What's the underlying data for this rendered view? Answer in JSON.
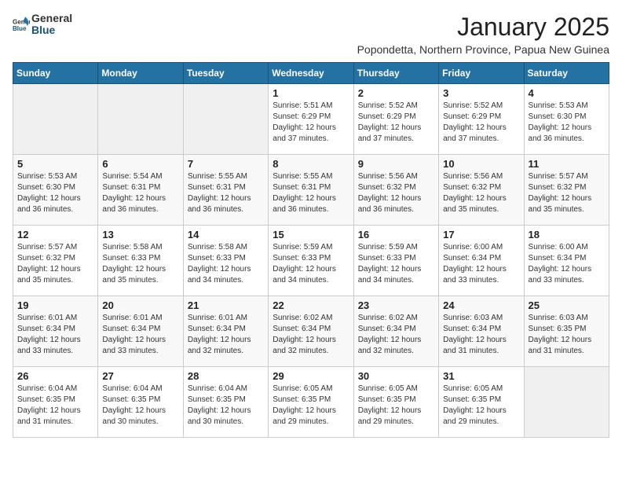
{
  "logo": {
    "text_general": "General",
    "text_blue": "Blue"
  },
  "title": "January 2025",
  "location": "Popondetta, Northern Province, Papua New Guinea",
  "days_of_week": [
    "Sunday",
    "Monday",
    "Tuesday",
    "Wednesday",
    "Thursday",
    "Friday",
    "Saturday"
  ],
  "weeks": [
    [
      {
        "day": "",
        "content": ""
      },
      {
        "day": "",
        "content": ""
      },
      {
        "day": "",
        "content": ""
      },
      {
        "day": "1",
        "content": "Sunrise: 5:51 AM\nSunset: 6:29 PM\nDaylight: 12 hours\nand 37 minutes."
      },
      {
        "day": "2",
        "content": "Sunrise: 5:52 AM\nSunset: 6:29 PM\nDaylight: 12 hours\nand 37 minutes."
      },
      {
        "day": "3",
        "content": "Sunrise: 5:52 AM\nSunset: 6:29 PM\nDaylight: 12 hours\nand 37 minutes."
      },
      {
        "day": "4",
        "content": "Sunrise: 5:53 AM\nSunset: 6:30 PM\nDaylight: 12 hours\nand 36 minutes."
      }
    ],
    [
      {
        "day": "5",
        "content": "Sunrise: 5:53 AM\nSunset: 6:30 PM\nDaylight: 12 hours\nand 36 minutes."
      },
      {
        "day": "6",
        "content": "Sunrise: 5:54 AM\nSunset: 6:31 PM\nDaylight: 12 hours\nand 36 minutes."
      },
      {
        "day": "7",
        "content": "Sunrise: 5:55 AM\nSunset: 6:31 PM\nDaylight: 12 hours\nand 36 minutes."
      },
      {
        "day": "8",
        "content": "Sunrise: 5:55 AM\nSunset: 6:31 PM\nDaylight: 12 hours\nand 36 minutes."
      },
      {
        "day": "9",
        "content": "Sunrise: 5:56 AM\nSunset: 6:32 PM\nDaylight: 12 hours\nand 36 minutes."
      },
      {
        "day": "10",
        "content": "Sunrise: 5:56 AM\nSunset: 6:32 PM\nDaylight: 12 hours\nand 35 minutes."
      },
      {
        "day": "11",
        "content": "Sunrise: 5:57 AM\nSunset: 6:32 PM\nDaylight: 12 hours\nand 35 minutes."
      }
    ],
    [
      {
        "day": "12",
        "content": "Sunrise: 5:57 AM\nSunset: 6:32 PM\nDaylight: 12 hours\nand 35 minutes."
      },
      {
        "day": "13",
        "content": "Sunrise: 5:58 AM\nSunset: 6:33 PM\nDaylight: 12 hours\nand 35 minutes."
      },
      {
        "day": "14",
        "content": "Sunrise: 5:58 AM\nSunset: 6:33 PM\nDaylight: 12 hours\nand 34 minutes."
      },
      {
        "day": "15",
        "content": "Sunrise: 5:59 AM\nSunset: 6:33 PM\nDaylight: 12 hours\nand 34 minutes."
      },
      {
        "day": "16",
        "content": "Sunrise: 5:59 AM\nSunset: 6:33 PM\nDaylight: 12 hours\nand 34 minutes."
      },
      {
        "day": "17",
        "content": "Sunrise: 6:00 AM\nSunset: 6:34 PM\nDaylight: 12 hours\nand 33 minutes."
      },
      {
        "day": "18",
        "content": "Sunrise: 6:00 AM\nSunset: 6:34 PM\nDaylight: 12 hours\nand 33 minutes."
      }
    ],
    [
      {
        "day": "19",
        "content": "Sunrise: 6:01 AM\nSunset: 6:34 PM\nDaylight: 12 hours\nand 33 minutes."
      },
      {
        "day": "20",
        "content": "Sunrise: 6:01 AM\nSunset: 6:34 PM\nDaylight: 12 hours\nand 33 minutes."
      },
      {
        "day": "21",
        "content": "Sunrise: 6:01 AM\nSunset: 6:34 PM\nDaylight: 12 hours\nand 32 minutes."
      },
      {
        "day": "22",
        "content": "Sunrise: 6:02 AM\nSunset: 6:34 PM\nDaylight: 12 hours\nand 32 minutes."
      },
      {
        "day": "23",
        "content": "Sunrise: 6:02 AM\nSunset: 6:34 PM\nDaylight: 12 hours\nand 32 minutes."
      },
      {
        "day": "24",
        "content": "Sunrise: 6:03 AM\nSunset: 6:34 PM\nDaylight: 12 hours\nand 31 minutes."
      },
      {
        "day": "25",
        "content": "Sunrise: 6:03 AM\nSunset: 6:35 PM\nDaylight: 12 hours\nand 31 minutes."
      }
    ],
    [
      {
        "day": "26",
        "content": "Sunrise: 6:04 AM\nSunset: 6:35 PM\nDaylight: 12 hours\nand 31 minutes."
      },
      {
        "day": "27",
        "content": "Sunrise: 6:04 AM\nSunset: 6:35 PM\nDaylight: 12 hours\nand 30 minutes."
      },
      {
        "day": "28",
        "content": "Sunrise: 6:04 AM\nSunset: 6:35 PM\nDaylight: 12 hours\nand 30 minutes."
      },
      {
        "day": "29",
        "content": "Sunrise: 6:05 AM\nSunset: 6:35 PM\nDaylight: 12 hours\nand 29 minutes."
      },
      {
        "day": "30",
        "content": "Sunrise: 6:05 AM\nSunset: 6:35 PM\nDaylight: 12 hours\nand 29 minutes."
      },
      {
        "day": "31",
        "content": "Sunrise: 6:05 AM\nSunset: 6:35 PM\nDaylight: 12 hours\nand 29 minutes."
      },
      {
        "day": "",
        "content": ""
      }
    ]
  ]
}
